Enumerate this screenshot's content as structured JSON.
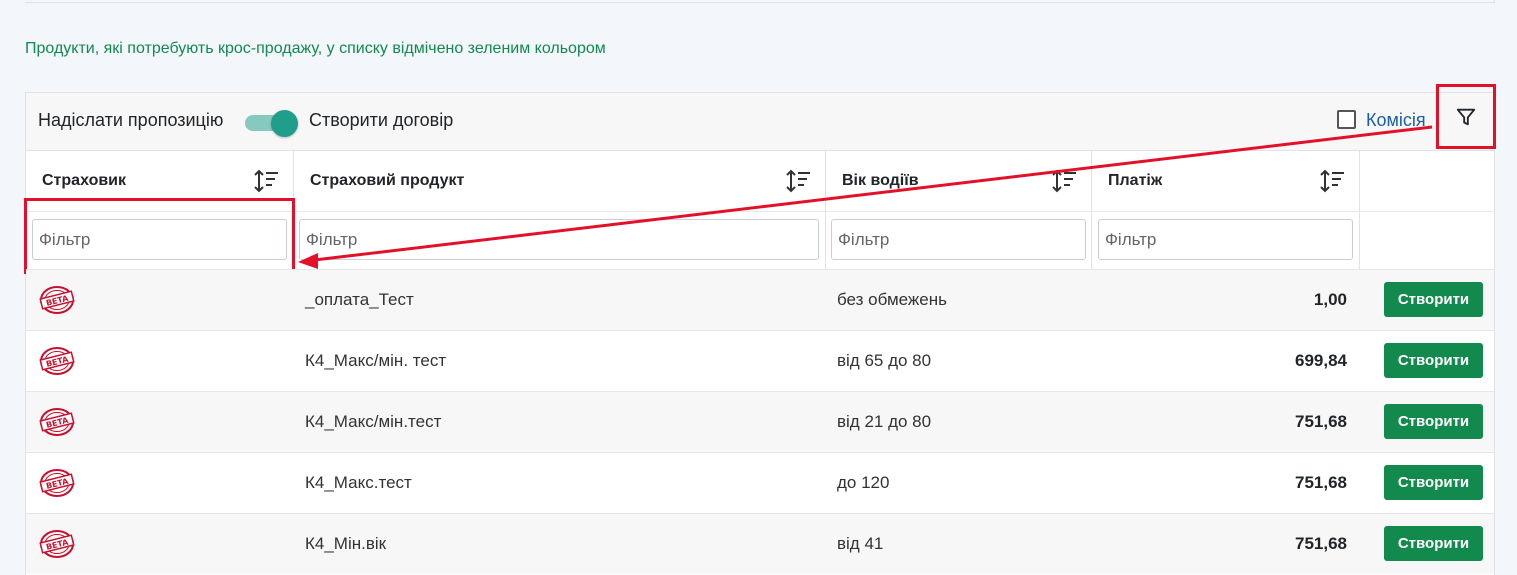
{
  "notice": "Продукти, які потребують крос-продажу, у списку відмічено зеленим кольором",
  "toolbar": {
    "send_offer_label": "Надіслати пропозицію",
    "create_contract_label": "Створити договір",
    "toggle_on": true,
    "commission_label": "Комісія",
    "commission_checked": false
  },
  "columns": [
    {
      "label": "Страховик"
    },
    {
      "label": "Страховий продукт"
    },
    {
      "label": "Вік водіїв"
    },
    {
      "label": "Платіж"
    }
  ],
  "filters": {
    "placeholder": "Фільтр"
  },
  "rows": [
    {
      "insurer_badge": "BETA",
      "product": "_оплата_Тест",
      "age": "без обмежень",
      "payment": "1,00",
      "action": "Створити"
    },
    {
      "insurer_badge": "BETA",
      "product": "К4_Макс/мін. тест",
      "age": "від 65 до 80",
      "payment": "699,84",
      "action": "Створити"
    },
    {
      "insurer_badge": "BETA",
      "product": "К4_Макс/мін.тест",
      "age": "від 21 до 80",
      "payment": "751,68",
      "action": "Створити"
    },
    {
      "insurer_badge": "BETA",
      "product": "К4_Макс.тест",
      "age": "до 120",
      "payment": "751,68",
      "action": "Створити"
    },
    {
      "insurer_badge": "BETA",
      "product": "К4_Мін.вік",
      "age": "від 41",
      "payment": "751,68",
      "action": "Створити"
    }
  ],
  "colors": {
    "accent_green": "#138a4d",
    "annotation_red": "#e3102a",
    "toggle_teal": "#1f9e8b",
    "link_blue": "#1a5ea8"
  }
}
